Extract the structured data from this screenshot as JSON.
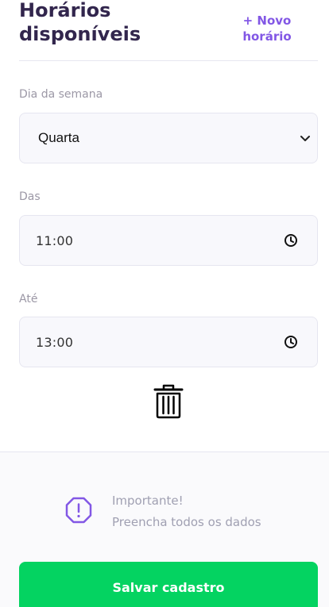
{
  "header": {
    "title": "Horários disponíveis",
    "new_button": "+ Novo horário"
  },
  "form": {
    "weekday": {
      "label": "Dia da semana",
      "value": "Quarta"
    },
    "from": {
      "label": "Das",
      "value": "11:00"
    },
    "to": {
      "label": "Até",
      "value": "13:00"
    }
  },
  "footer": {
    "warning_title": "Importante!",
    "warning_text": "Preencha todos os dados",
    "save_button": "Salvar cadastro"
  },
  "colors": {
    "primary": "#8257e5",
    "success": "#04d361",
    "title": "#32264d"
  },
  "icons": {
    "select": "chevron-down-icon",
    "time": "clock-icon",
    "delete": "trash-icon",
    "warning": "warning-icon"
  }
}
